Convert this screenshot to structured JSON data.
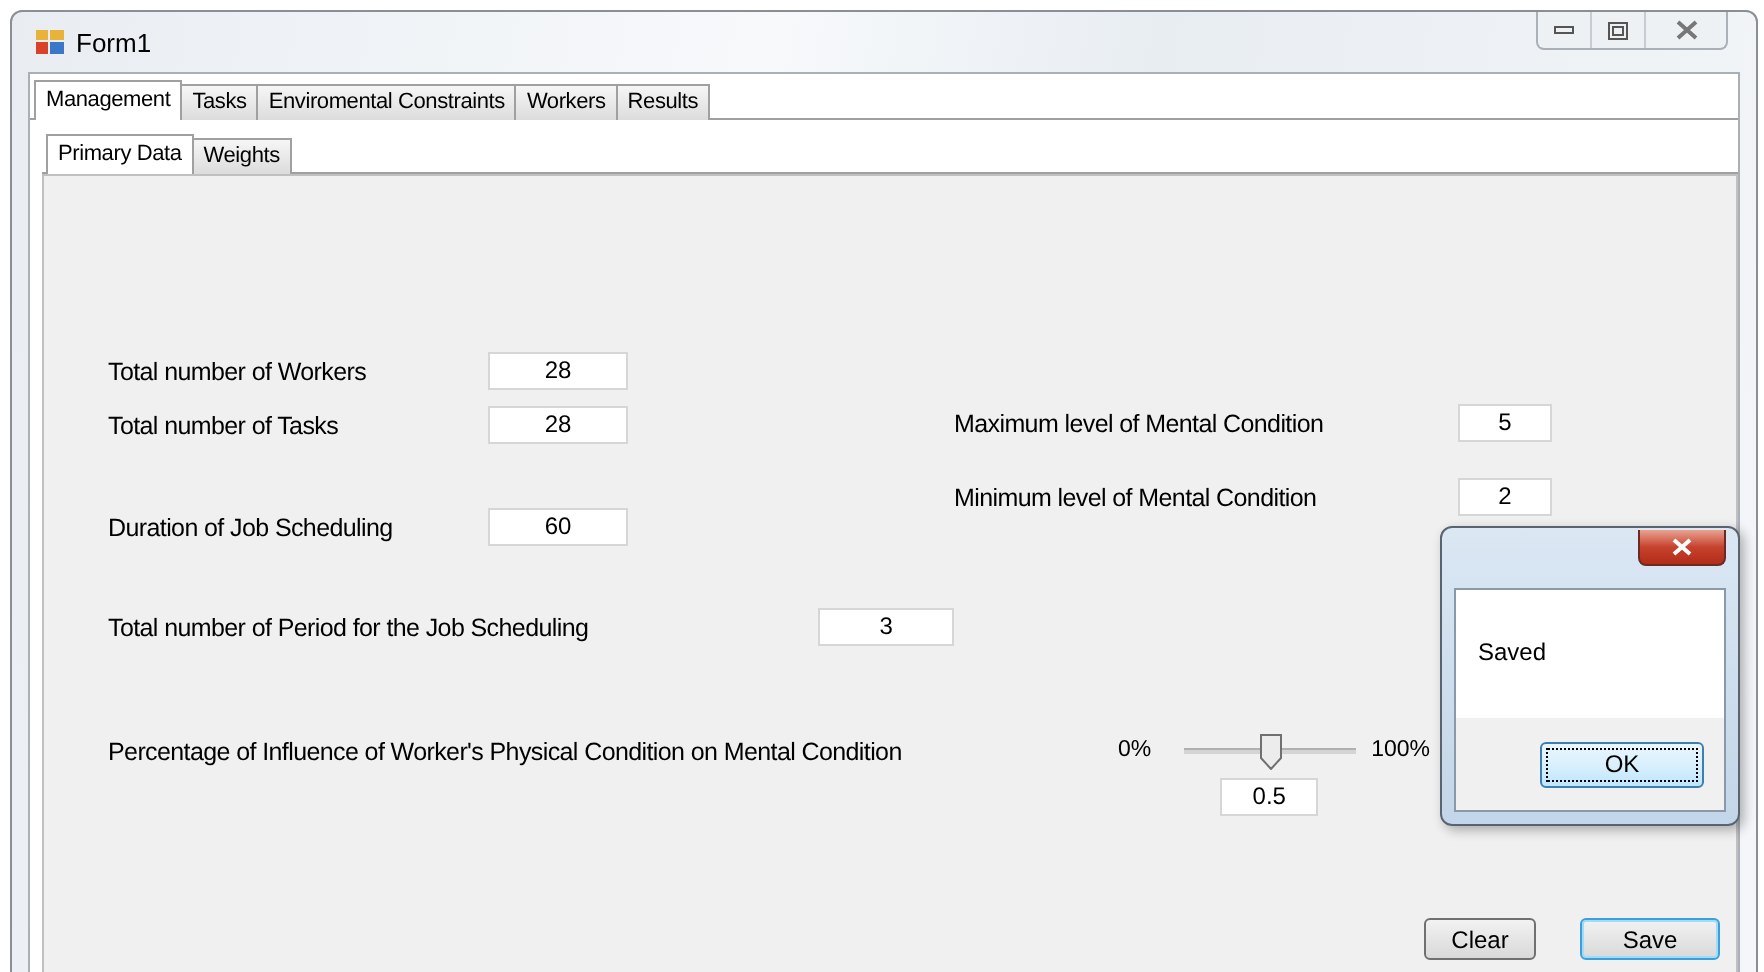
{
  "window": {
    "title": "Form1"
  },
  "tabs": [
    {
      "label": "Management",
      "selected": true
    },
    {
      "label": "Tasks",
      "selected": false
    },
    {
      "label": "Enviromental Constraints",
      "selected": false
    },
    {
      "label": "Workers",
      "selected": false
    },
    {
      "label": "Results",
      "selected": false
    }
  ],
  "subtabs": [
    {
      "label": "Primary Data",
      "selected": true
    },
    {
      "label": "Weights",
      "selected": false
    }
  ],
  "left_fields": [
    {
      "label": "Total number of Workers",
      "value": "28"
    },
    {
      "label": "Total number of Tasks",
      "value": "28"
    },
    {
      "label": "Duration of Job Scheduling",
      "value": "60"
    }
  ],
  "right_fields": [
    {
      "label": "Maximum level of Mental Condition",
      "value": "5"
    },
    {
      "label": "Minimum level of Mental Condition",
      "value": "2"
    }
  ],
  "period_field": {
    "label": "Total number of Period for the Job Scheduling",
    "value": "3"
  },
  "influence": {
    "label": "Percentage of Influence of Worker's Physical Condition on Mental Condition",
    "min_label": "0%",
    "max_label": "100%",
    "level": 0.5,
    "value": "0.5"
  },
  "buttons": [
    {
      "label": "Clear",
      "focused": false
    },
    {
      "label": "Save",
      "focused": true
    }
  ],
  "dialog": {
    "message": "Saved",
    "button": "OK"
  }
}
